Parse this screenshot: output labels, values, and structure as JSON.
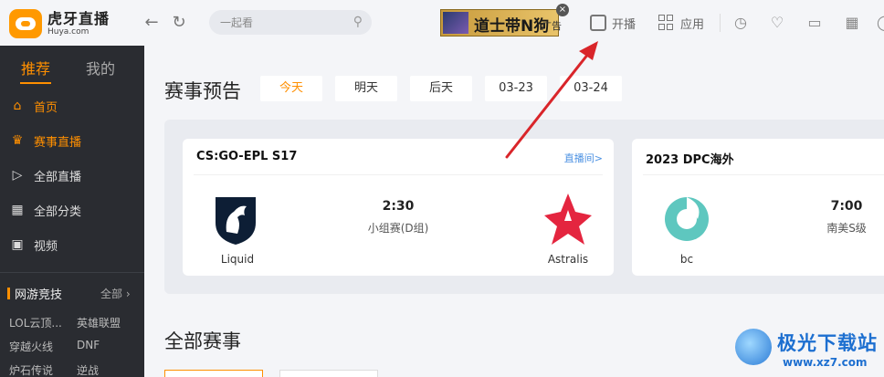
{
  "app": {
    "logo_cn": "虎牙直播",
    "logo_en": "Huya.com"
  },
  "header": {
    "search_placeholder": "一起看",
    "ad_text": "道士带N狗",
    "ad_tag": "广告",
    "ad_close": "×",
    "broadcast_label": "开播",
    "apps_label": "应用",
    "icons": [
      "history-icon",
      "heart-icon",
      "message-icon",
      "calendar-icon",
      "user-icon"
    ]
  },
  "sidebar": {
    "tabs": [
      {
        "label": "推荐",
        "active": true
      },
      {
        "label": "我的",
        "active": false
      }
    ],
    "items": [
      {
        "label": "首页",
        "icon": "home-icon",
        "active": true
      },
      {
        "label": "赛事直播",
        "icon": "trophy-icon",
        "active": true
      },
      {
        "label": "全部直播",
        "icon": "play-icon",
        "active": false
      },
      {
        "label": "全部分类",
        "icon": "grid-icon",
        "active": false
      },
      {
        "label": "视频",
        "icon": "tv-icon",
        "active": false
      }
    ],
    "section": {
      "title": "网游竞技",
      "all": "全部"
    },
    "games": [
      {
        "label": "LOL云顶..."
      },
      {
        "label": "英雄联盟"
      },
      {
        "label": "穿越火线"
      },
      {
        "label": "DNF"
      },
      {
        "label": "炉石传说"
      },
      {
        "label": "逆战"
      }
    ]
  },
  "main": {
    "title": "赛事预告",
    "date_tabs": [
      {
        "label": "今天",
        "active": true
      },
      {
        "label": "明天",
        "active": false
      },
      {
        "label": "后天",
        "active": false
      },
      {
        "label": "03-23",
        "active": false
      },
      {
        "label": "03-24",
        "active": false
      }
    ],
    "cards": [
      {
        "title": "CS:GO-EPL S17",
        "link": "直播间>",
        "team_a": "Liquid",
        "team_b": "Astralis",
        "time": "2:30",
        "stage": "小组赛(D组)"
      },
      {
        "title": "2023 DPC海外",
        "team_a": "bc",
        "time": "7:00",
        "stage": "南美S级"
      }
    ],
    "section2_title": "全部赛事"
  },
  "watermark": {
    "text": "极光下载站",
    "url": "www.xz7.com"
  },
  "colors": {
    "accent": "#ff8f00",
    "sidebar_bg": "#2a2c31",
    "page_bg": "#f4f5f8",
    "link": "#4a90e2",
    "annotation_arrow": "#d9252a"
  }
}
